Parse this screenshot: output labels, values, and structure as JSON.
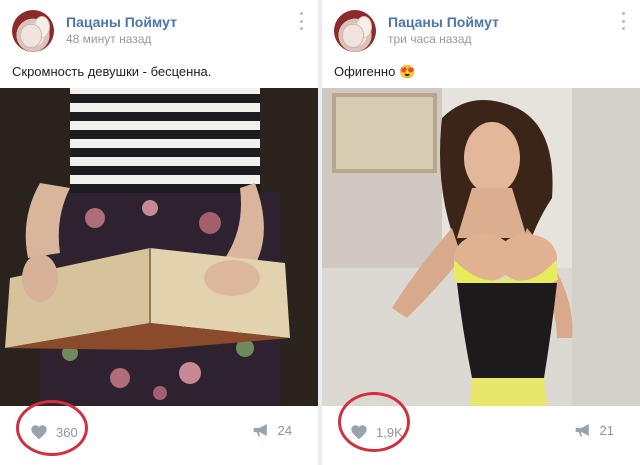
{
  "posts": [
    {
      "author": "Пацаны Поймут",
      "time": "48 минут назад",
      "caption": "Скромность девушки - бесценна.",
      "likes": "360",
      "reposts": "24"
    },
    {
      "author": "Пацаны Поймут",
      "time": "три часа назад",
      "caption": "Офигенно 😍",
      "likes": "1,9K",
      "reposts": "21"
    }
  ],
  "highlight_color": "#d32f3f",
  "link_color": "#4a76a8"
}
